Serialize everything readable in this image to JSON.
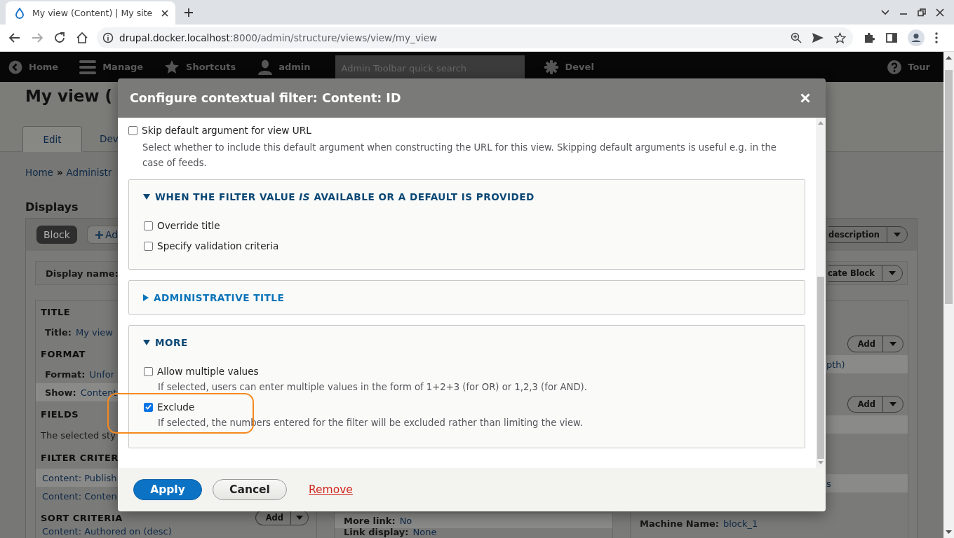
{
  "browser": {
    "tab_title": "My view (Content) | My site",
    "url_host": "drupal.docker.localhost",
    "url_rest": ":8000/admin/structure/views/view/my_view"
  },
  "toolbar": {
    "items": [
      {
        "label": "Home"
      },
      {
        "label": "Manage"
      },
      {
        "label": "Shortcuts"
      },
      {
        "label": "admin"
      }
    ],
    "search": {
      "placeholder": "Admin Toolbar quick search"
    },
    "devel": "Devel",
    "tour": "Tour"
  },
  "page": {
    "title": "My view (",
    "tabs": [
      {
        "label": "Edit",
        "selected": true
      },
      {
        "label": "Dev",
        "selected": false
      }
    ],
    "breadcrumb": {
      "items": [
        "Home",
        "Administr"
      ],
      "separator": "»"
    },
    "displays": {
      "heading": "Displays",
      "tabs": [
        {
          "label": "Block",
          "selected": true
        }
      ],
      "add_button": "Ad",
      "edit_menu": "description",
      "display_name_label": "Display name:",
      "duplicate_menu": "cate Block"
    },
    "left_sections": [
      {
        "heading": "TITLE",
        "rows": [
          {
            "label": "Title:",
            "value": "My view",
            "highlighted": false
          }
        ]
      },
      {
        "heading": "FORMAT",
        "rows": [
          {
            "label": "Format:",
            "value": "Unfor",
            "highlighted": false
          },
          {
            "label": "Show:",
            "value": "Content",
            "highlighted": true
          }
        ]
      },
      {
        "heading": "FIELDS",
        "text": "The selected sty"
      },
      {
        "heading": "FILTER CRITER",
        "links": [
          {
            "label": "Content: Publish",
            "highlighted": true
          },
          {
            "label": "Content: Conten",
            "highlighted": false
          }
        ]
      },
      {
        "heading": "SORT CRITERIA",
        "add_button": "Add",
        "links": [
          {
            "label": "Content: Authored on (desc)",
            "highlighted": false
          }
        ]
      }
    ],
    "middle_rows": [
      {
        "label": "More link:",
        "value": "No",
        "highlighted": true
      },
      {
        "label": "Link display:",
        "value": "None",
        "highlighted": false
      }
    ],
    "right": {
      "add_buttons": [
        "Add",
        "Add"
      ],
      "links": [
        "pth)",
        "s"
      ],
      "machine_name": {
        "label": "Machine Name:",
        "value": "block_1"
      }
    }
  },
  "dialog": {
    "title": "Configure contextual filter: Content: ID",
    "skip": {
      "label": "Skip default argument for view URL",
      "checked": false,
      "description": "Select whether to include this default argument when constructing the URL for this view. Skipping default arguments is useful e.g. in the case of feeds."
    },
    "groups": [
      {
        "summary": "WHEN THE FILTER VALUE *IS* AVAILABLE OR A DEFAULT IS PROVIDED",
        "expanded": true,
        "options": [
          {
            "label": "Override title",
            "checked": false
          },
          {
            "label": "Specify validation criteria",
            "checked": false
          }
        ]
      },
      {
        "summary": "ADMINISTRATIVE TITLE",
        "expanded": false
      },
      {
        "summary": "MORE",
        "expanded": true,
        "options": [
          {
            "label": "Allow multiple values",
            "checked": false,
            "description": "If selected, users can enter multiple values in the form of 1+2+3 (for OR) or 1,2,3 (for AND)."
          },
          {
            "label": "Exclude",
            "checked": true,
            "description": "If selected, the numbers entered for the filter will be excluded rather than limiting the view."
          }
        ]
      }
    ],
    "buttons": {
      "apply": "Apply",
      "cancel": "Cancel",
      "remove": "Remove"
    }
  }
}
